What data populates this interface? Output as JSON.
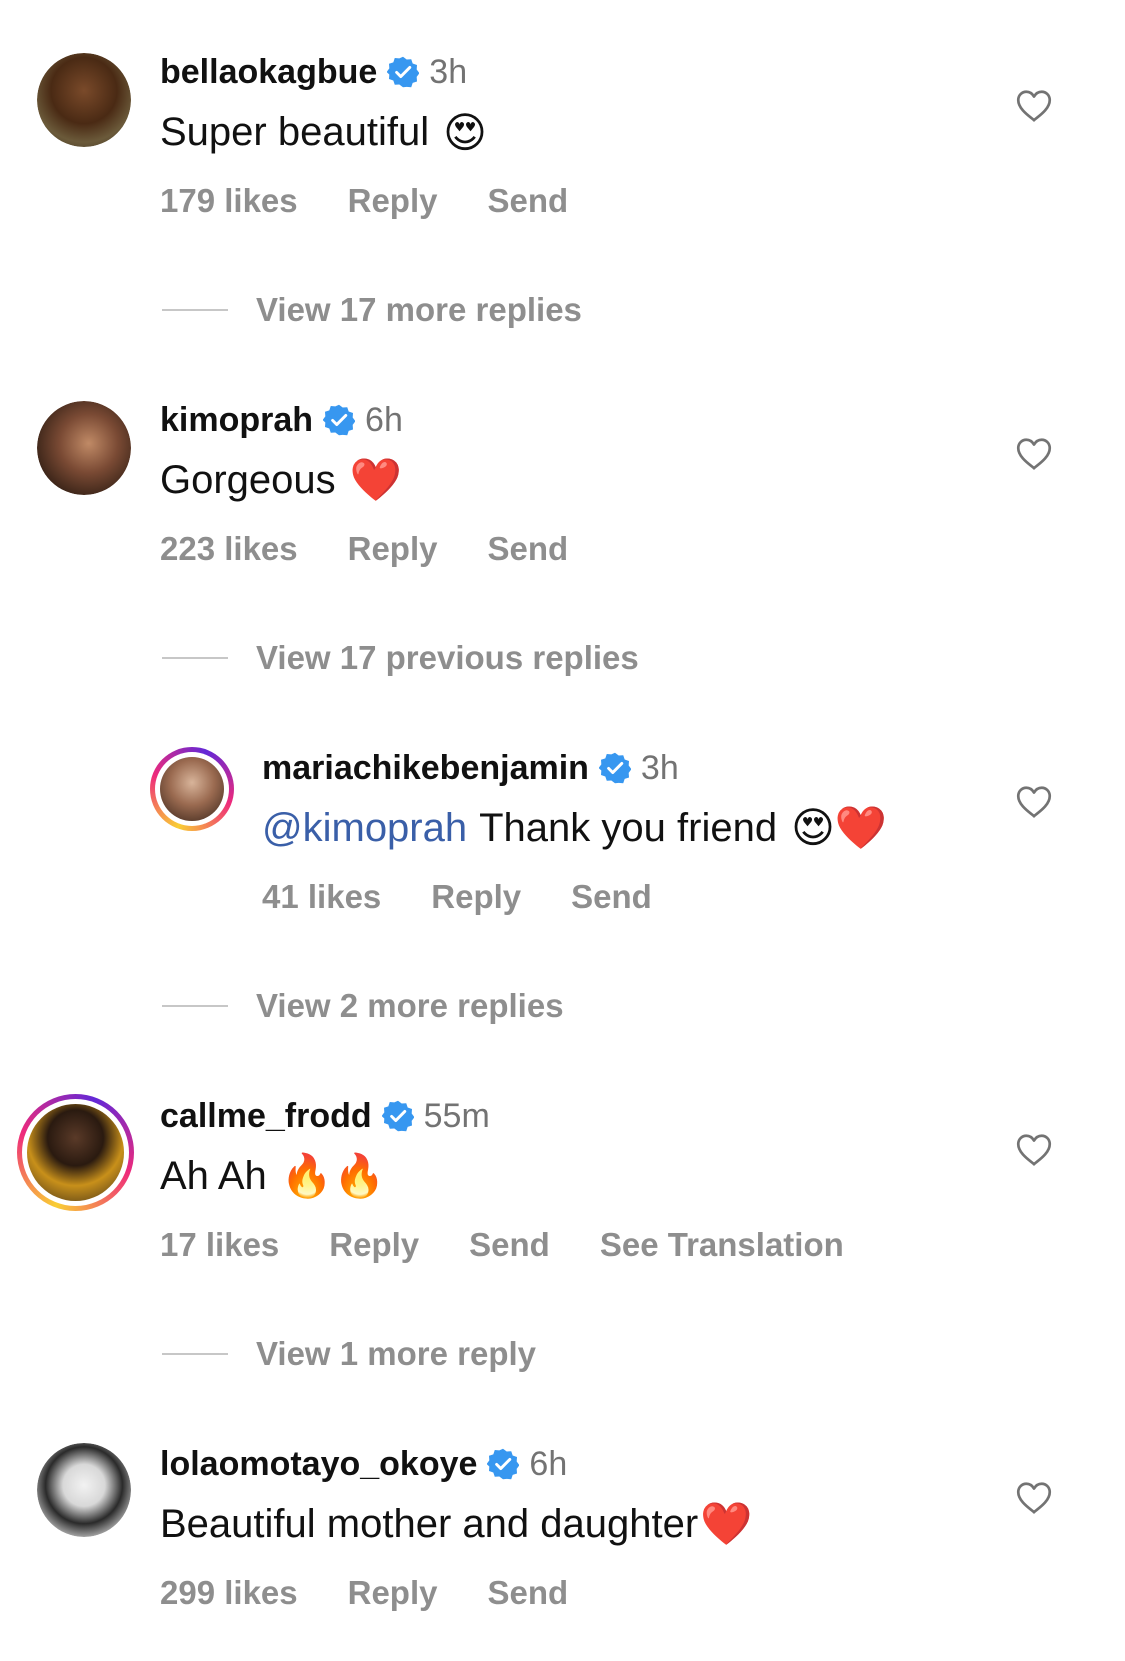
{
  "comments": [
    {
      "username": "bellaokagbue",
      "time": "3h",
      "text": "Super beautiful",
      "emoji": "😍",
      "likes": "179 likes",
      "reply": "Reply",
      "send": "Send",
      "view_more": "View 17 more replies"
    },
    {
      "username": "kimoprah",
      "time": "6h",
      "text": "Gorgeous",
      "emoji": "❤️",
      "likes": "223 likes",
      "reply": "Reply",
      "send": "Send",
      "view_previous": "View 17 previous replies"
    },
    {
      "username": "mariachikebenjamin",
      "time": "3h",
      "mention": "@kimoprah",
      "text": "Thank you friend",
      "emoji": "😍❤️",
      "likes": "41 likes",
      "reply": "Reply",
      "send": "Send",
      "view_more": "View 2 more replies"
    },
    {
      "username": "callme_frodd",
      "time": "55m",
      "text": "Ah Ah",
      "emoji": "🔥🔥",
      "likes": "17 likes",
      "reply": "Reply",
      "send": "Send",
      "see_translation": "See Translation",
      "view_more": "View 1 more reply"
    },
    {
      "username": "lolaomotayo_okoye",
      "time": "6h",
      "text": "Beautiful mother and daughter",
      "emoji": "❤️",
      "likes": "299 likes",
      "reply": "Reply",
      "send": "Send"
    }
  ],
  "colors": {
    "verified": "#3797f0",
    "secondary_text": "#8e8e8e",
    "mention": "#3a5fa8"
  }
}
